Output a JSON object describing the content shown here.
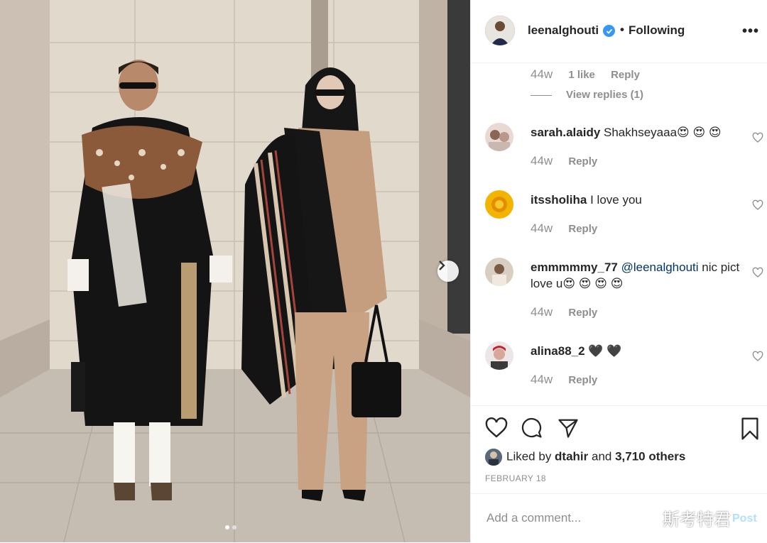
{
  "header": {
    "username": "leenalghouti",
    "separator": "•",
    "follow_status": "Following",
    "more_label": "•••"
  },
  "reply_meta": {
    "time": "44w",
    "likes": "1 like",
    "reply": "Reply",
    "view_replies": "View replies (1)"
  },
  "comments": [
    {
      "user": "sarah.alaidy",
      "text": "Shakhseyaaa😍 😍 😍",
      "time": "44w",
      "reply": "Reply"
    },
    {
      "user": "itssholiha",
      "text": "I love you",
      "time": "44w",
      "reply": "Reply"
    },
    {
      "user": "emmmmmy_77",
      "mention": "@leenalghouti",
      "text": " nic pict love u😍 😍 😍 😍",
      "time": "44w",
      "reply": "Reply"
    },
    {
      "user": "alina88_2",
      "text": "🖤 🖤",
      "time": "44w",
      "reply": "Reply"
    }
  ],
  "likes_info": {
    "prefix": "Liked by ",
    "liker": "dtahir",
    "middle": " and ",
    "others": "3,710 others"
  },
  "date": "FEBRUARY 18",
  "comment_box": {
    "placeholder": "Add a comment...",
    "post_label": "Post"
  },
  "watermark": "斯考特君",
  "carousel": {
    "total": 2,
    "current": 1
  },
  "colors": {
    "verified": "#3897f0",
    "post_disabled": "#b2dffc",
    "meta_gray": "#8e8e8e",
    "border": "#efefef"
  }
}
